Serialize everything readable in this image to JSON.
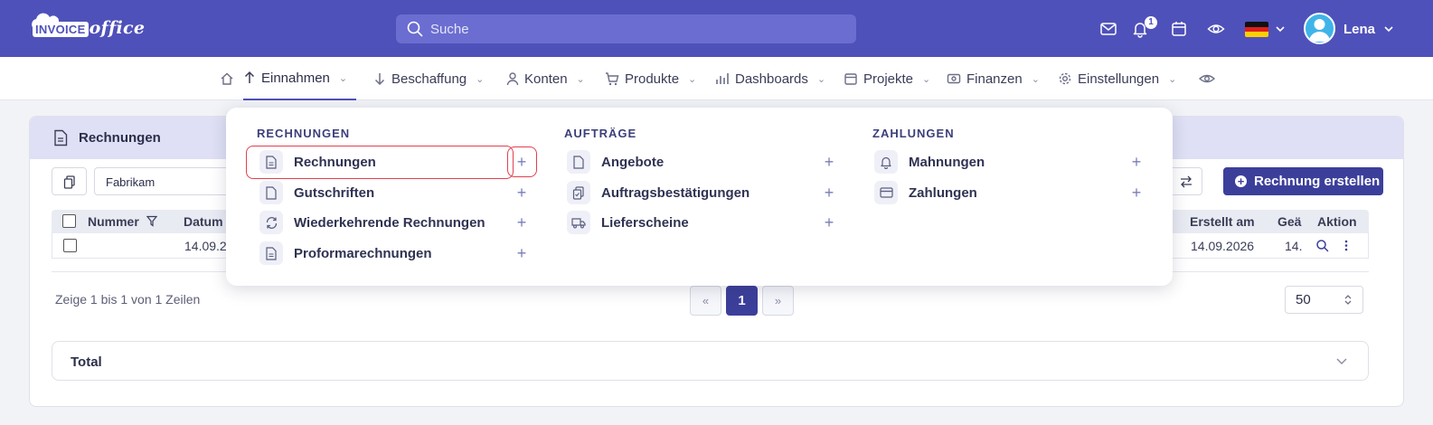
{
  "brand": {
    "logo_invoice": "INVOICE",
    "logo_office": "office"
  },
  "header": {
    "search_placeholder": "Suche",
    "notification_count": "1",
    "user_name": "Lena"
  },
  "nav": {
    "items": [
      {
        "label": "Einnahmen"
      },
      {
        "label": "Beschaffung"
      },
      {
        "label": "Konten"
      },
      {
        "label": "Produkte"
      },
      {
        "label": "Dashboards"
      },
      {
        "label": "Projekte"
      },
      {
        "label": "Finanzen"
      },
      {
        "label": "Einstellungen"
      }
    ]
  },
  "page": {
    "title": "Rechnungen",
    "filter_value": "Fabrikam",
    "create_button": "Rechnung erstellen",
    "table": {
      "headers": {
        "number": "Nummer",
        "date": "Datum",
        "created": "Erstellt am",
        "changed": "Geä",
        "action": "Aktion"
      },
      "rows": [
        {
          "number": "",
          "date": "14.09.2",
          "created": "14.09.2026",
          "changed": "14."
        }
      ]
    },
    "info": "Zeige 1 bis 1 von 1 Zeilen",
    "pagination": {
      "prev": "«",
      "current": "1",
      "next": "»"
    },
    "page_size": "50",
    "total_label": "Total"
  },
  "dropdown": {
    "sections": [
      {
        "title": "RECHNUNGEN",
        "items": [
          {
            "label": "Rechnungen"
          },
          {
            "label": "Gutschriften"
          },
          {
            "label": "Wiederkehrende Rechnungen"
          },
          {
            "label": "Proformarechnungen"
          }
        ]
      },
      {
        "title": "AUFTRÄGE",
        "items": [
          {
            "label": "Angebote"
          },
          {
            "label": "Auftragsbestätigungen"
          },
          {
            "label": "Lieferscheine"
          }
        ]
      },
      {
        "title": "ZAHLUNGEN",
        "items": [
          {
            "label": "Mahnungen"
          },
          {
            "label": "Zahlungen"
          }
        ]
      }
    ]
  },
  "colors": {
    "header_bg": "#4f51ba",
    "primary": "#3c3f9a",
    "highlight": "#e0414f"
  }
}
